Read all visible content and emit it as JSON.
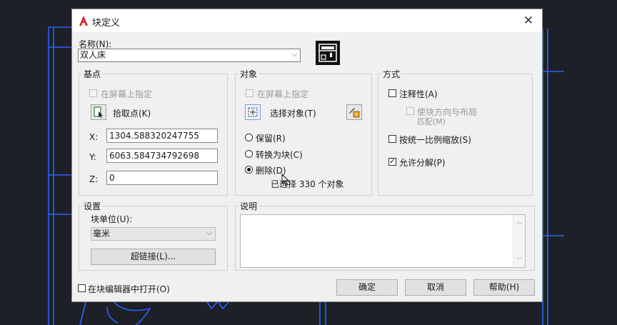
{
  "dialog": {
    "title": "块定义",
    "close": "✕"
  },
  "name": {
    "label": "名称(N):",
    "value": "双人床"
  },
  "basepoint": {
    "title": "基点",
    "specify_on_screen": "在屏幕上指定",
    "pick_point": "拾取点(K)",
    "x_label": "X:",
    "x_value": "1304.588320247755",
    "y_label": "Y:",
    "y_value": "6063.584734792698",
    "z_label": "Z:",
    "z_value": "0"
  },
  "objects": {
    "title": "对象",
    "specify_on_screen": "在屏幕上指定",
    "select_objects": "选择对象(T)",
    "retain": "保留(R)",
    "convert": "转换为块(C)",
    "delete": "删除(D)",
    "delete_selected": true,
    "selected_text": "已选择 330 个对象"
  },
  "behavior": {
    "title": "方式",
    "annotative": "注释性(A)",
    "annotative_checked": false,
    "match_orientation_line1": "使块方向与布局",
    "match_orientation_line2": "匹配(M)",
    "scale_uniformly": "按统一比例缩放(S)",
    "scale_uniformly_checked": false,
    "allow_explode": "允许分解(P)",
    "allow_explode_checked": true
  },
  "settings": {
    "title": "设置",
    "unit_label": "块单位(U):",
    "unit_value": "毫米",
    "hyperlink": "超链接(L)..."
  },
  "description": {
    "title": "说明"
  },
  "footer": {
    "open_in_editor": "在块编辑器中打开(O)",
    "ok": "确定",
    "cancel": "取消",
    "help": "帮助(H)"
  }
}
